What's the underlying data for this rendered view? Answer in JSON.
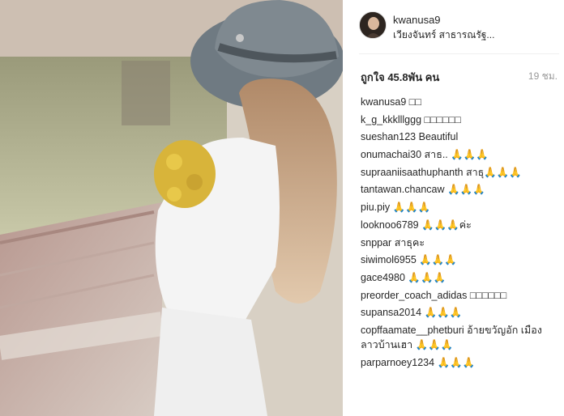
{
  "post": {
    "username": "kwanusa9",
    "location": "เวียงจันทร์ สาธารณรัฐ...",
    "likes": "ถูกใจ 45.8พัน คน",
    "time": "19 ชม."
  },
  "comments": [
    {
      "user": "kwanusa9",
      "text": "□□"
    },
    {
      "user": "k_g_kkklllggg",
      "text": "□□□□□□"
    },
    {
      "user": "sueshan123",
      "text": "Beautiful"
    },
    {
      "user": "onumachai30",
      "text": "สาธ.. 🙏🙏🙏"
    },
    {
      "user": "supraaniisaathuphanth",
      "text": "สาธุ🙏🙏🙏"
    },
    {
      "user": "tantawan.chancaw",
      "text": "🙏🙏🙏"
    },
    {
      "user": "piu.piy",
      "text": "🙏🙏🙏"
    },
    {
      "user": "looknoo6789",
      "text": "🙏🙏🙏ค่ะ"
    },
    {
      "user": "snppar",
      "text": "สาธุคะ"
    },
    {
      "user": "siwimol6955",
      "text": "🙏🙏🙏"
    },
    {
      "user": "gace4980",
      "text": "🙏🙏🙏"
    },
    {
      "user": "preorder_coach_adidas",
      "text": "□□□□□□"
    },
    {
      "user": "supansa2014",
      "text": "🙏🙏🙏"
    },
    {
      "user": "copffaamate__phetburi",
      "text": "อ้ายขวัญอัก เมืองลาวบ้านเฮา 🙏🙏🙏"
    },
    {
      "user": "parparnoey1234",
      "text": "🙏🙏🙏"
    }
  ]
}
